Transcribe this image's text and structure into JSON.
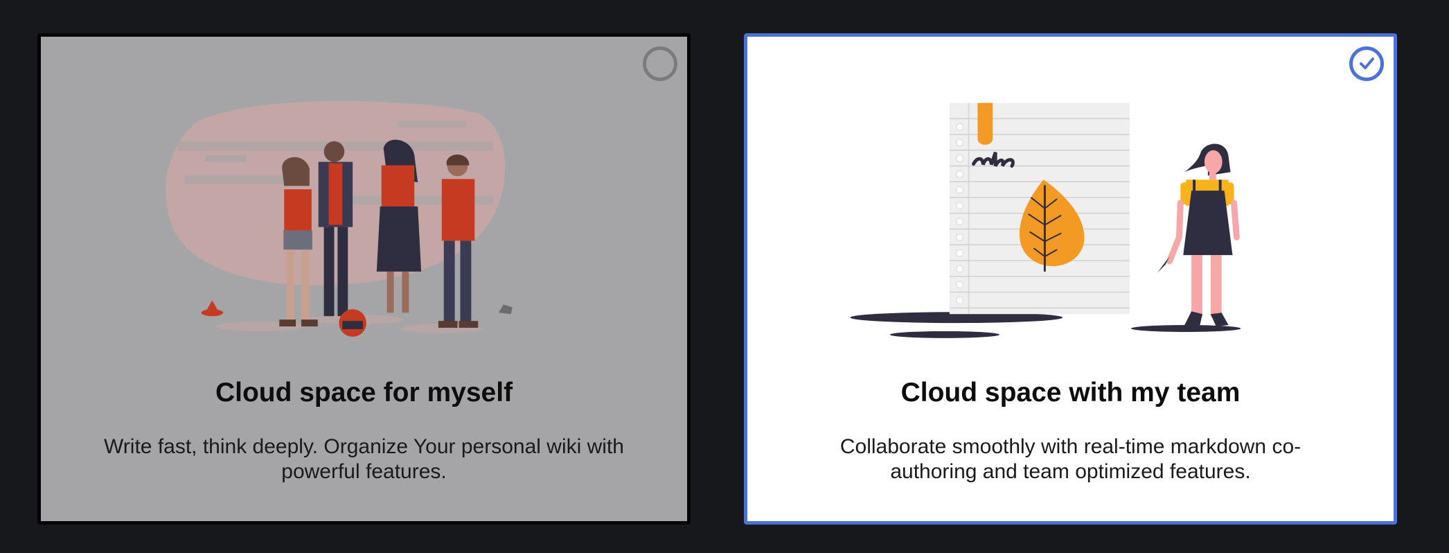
{
  "cards": [
    {
      "title": "Cloud space for myself",
      "description": "Write fast, think deeply. Organize Your personal wiki with powerful features.",
      "selected": false,
      "illustration": "people-group-illustration"
    },
    {
      "title": "Cloud space with my team",
      "description": "Collaborate smoothly with real-time markdown co-authoring and team optimized features.",
      "selected": true,
      "illustration": "notebook-woman-illustration"
    }
  ],
  "colors": {
    "background": "#17181c",
    "selected_border": "#4a72d8",
    "accent_orange": "#f29a24",
    "accent_red": "#c53a20",
    "dark_figure": "#2f2e41"
  },
  "icons": {
    "unselected": "radio-empty-icon",
    "selected": "check-circle-icon"
  }
}
